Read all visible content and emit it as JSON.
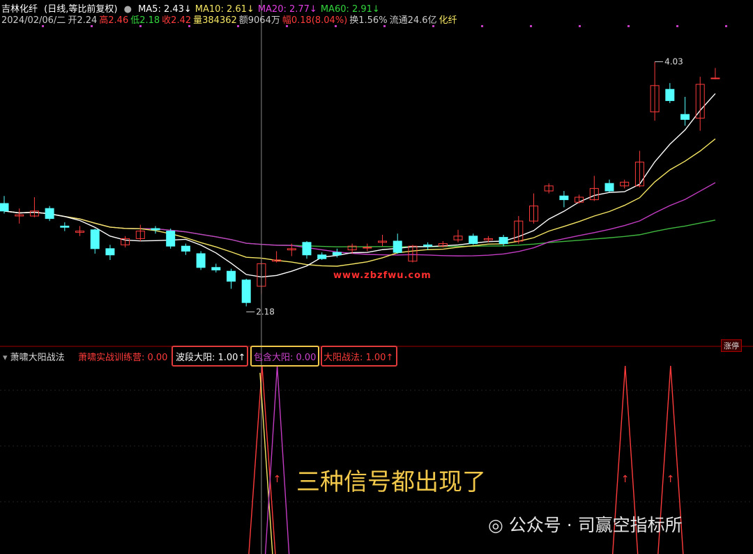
{
  "header": {
    "stock": "吉林化纤",
    "mode": "(日线,等比前复权)",
    "ma_items": [
      {
        "label": "MA5: 2.43↓",
        "color": "#ffffff"
      },
      {
        "label": "MA10: 2.61↓",
        "color": "#f5e663"
      },
      {
        "label": "MA20: 2.77↓",
        "color": "#e33ee3"
      },
      {
        "label": "MA60: 2.91↓",
        "color": "#33d63d"
      }
    ]
  },
  "quote": [
    {
      "text": "2024/02/06/二",
      "color": "#cccccc"
    },
    {
      "text": "开2.24",
      "color": "#cccccc"
    },
    {
      "text": "高2.46",
      "color": "#ff3b3b"
    },
    {
      "text": "低2.18",
      "color": "#33d63d"
    },
    {
      "text": "收2.42",
      "color": "#ff3b3b"
    },
    {
      "text": "量384362",
      "color": "#f5e663"
    },
    {
      "text": "额9064万",
      "color": "#cccccc"
    },
    {
      "text": "幅0.18(8.04%)",
      "color": "#ff3b3b"
    },
    {
      "text": "换1.56%",
      "color": "#cccccc"
    },
    {
      "text": "流通24.6亿",
      "color": "#cccccc"
    },
    {
      "text": "化纤",
      "color": "#f5e663"
    }
  ],
  "indicator": {
    "name": "萧啸大阳战法",
    "v1": "萧啸实战训练营: 0.00",
    "v2": "波段大阳: 1.00↑",
    "v3": "包含大阳: 0.00",
    "v4": "大阳战法: 1.00↑"
  },
  "price_labels": {
    "high": "4.03",
    "low": "2.18"
  },
  "url_text": "www.zbzfwu.com",
  "tag_text": "涨停",
  "caption": "三种信号都出现了",
  "watermark": "公众号 · 司赢空指标所",
  "colors": {
    "up": "#ff3b3b",
    "down": "#54ffff",
    "ma5": "#ffffff",
    "ma10": "#f5e663",
    "ma20": "#c33cc3",
    "ma60": "#3fb83f"
  },
  "chart_data": {
    "type": "candlestick",
    "ylim": [
      1.9,
      4.3
    ],
    "candles": [
      [
        2.9,
        2.84,
        2.96,
        2.82
      ],
      [
        2.8,
        2.81,
        2.86,
        2.74
      ],
      [
        2.8,
        2.84,
        2.95,
        2.79
      ],
      [
        2.86,
        2.78,
        2.88,
        2.76
      ],
      [
        2.72,
        2.71,
        2.75,
        2.68
      ],
      [
        2.67,
        2.68,
        2.72,
        2.64
      ],
      [
        2.69,
        2.54,
        2.7,
        2.5
      ],
      [
        2.54,
        2.49,
        2.57,
        2.45
      ],
      [
        2.57,
        2.62,
        2.64,
        2.55
      ],
      [
        2.62,
        2.68,
        2.73,
        2.6
      ],
      [
        2.7,
        2.69,
        2.72,
        2.66
      ],
      [
        2.68,
        2.56,
        2.7,
        2.54
      ],
      [
        2.56,
        2.52,
        2.58,
        2.49
      ],
      [
        2.5,
        2.39,
        2.52,
        2.37
      ],
      [
        2.39,
        2.37,
        2.42,
        2.35
      ],
      [
        2.36,
        2.28,
        2.38,
        2.22
      ],
      [
        2.29,
        2.11,
        2.3,
        2.08
      ],
      [
        2.24,
        2.42,
        2.46,
        2.18
      ],
      [
        2.44,
        2.45,
        2.52,
        2.43
      ],
      [
        2.53,
        2.54,
        2.58,
        2.48
      ],
      [
        2.59,
        2.49,
        2.6,
        2.46
      ],
      [
        2.49,
        2.46,
        2.51,
        2.45
      ],
      [
        2.51,
        2.49,
        2.54,
        2.47
      ],
      [
        2.53,
        2.56,
        2.58,
        2.5
      ],
      [
        2.55,
        2.55,
        2.58,
        2.52
      ],
      [
        2.59,
        2.6,
        2.65,
        2.56
      ],
      [
        2.6,
        2.51,
        2.66,
        2.5
      ],
      [
        2.44,
        2.56,
        2.57,
        2.43
      ],
      [
        2.57,
        2.56,
        2.59,
        2.53
      ],
      [
        2.56,
        2.58,
        2.6,
        2.55
      ],
      [
        2.61,
        2.64,
        2.69,
        2.59
      ],
      [
        2.64,
        2.58,
        2.66,
        2.57
      ],
      [
        2.61,
        2.62,
        2.64,
        2.59
      ],
      [
        2.63,
        2.58,
        2.65,
        2.56
      ],
      [
        2.6,
        2.76,
        2.8,
        2.58
      ],
      [
        2.76,
        2.88,
        2.98,
        2.74
      ],
      [
        3.0,
        3.04,
        3.06,
        2.98
      ],
      [
        2.96,
        2.93,
        3.0,
        2.87
      ],
      [
        2.91,
        2.95,
        2.97,
        2.9
      ],
      [
        2.93,
        3.02,
        3.12,
        2.92
      ],
      [
        3.06,
        3.0,
        3.09,
        2.99
      ],
      [
        3.04,
        3.07,
        3.09,
        3.02
      ],
      [
        3.04,
        3.23,
        3.32,
        3.03
      ],
      [
        3.63,
        3.84,
        4.03,
        3.56
      ],
      [
        3.81,
        3.72,
        3.86,
        3.7
      ],
      [
        3.61,
        3.57,
        3.75,
        3.52
      ],
      [
        3.58,
        3.85,
        3.91,
        3.48
      ],
      [
        3.9,
        3.9,
        3.98,
        3.89
      ]
    ],
    "signals": {
      "s1": [
        17
      ],
      "s2": [
        18
      ],
      "s3": [
        17
      ],
      "s4": [
        41,
        44
      ]
    }
  }
}
